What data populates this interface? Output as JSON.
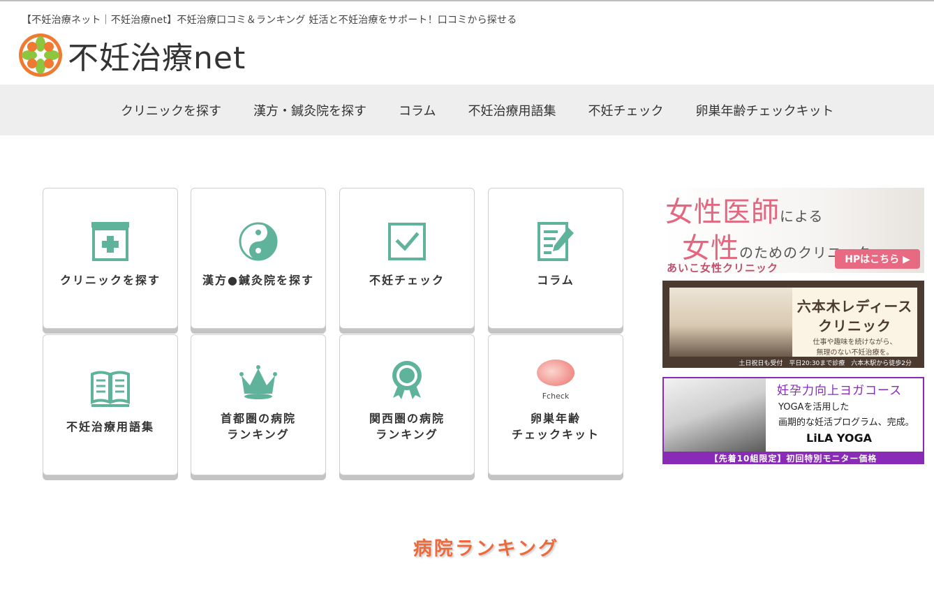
{
  "header": {
    "tagline": "【不妊治療ネット｜不妊治療net】不妊治療口コミ＆ランキング 妊活と不妊治療をサポート！口コミから探せる",
    "logo_text": "不妊治療net"
  },
  "nav": {
    "items": [
      {
        "label": "クリニックを探す"
      },
      {
        "label": "漢方・鍼灸院を探す"
      },
      {
        "label": "コラム"
      },
      {
        "label": "不妊治療用語集"
      },
      {
        "label": "不妊チェック"
      },
      {
        "label": "卵巣年齢チェックキット"
      }
    ]
  },
  "tiles": [
    {
      "icon": "clinic-icon",
      "lines": [
        "クリニックを探す"
      ]
    },
    {
      "icon": "yin-yang-icon",
      "lines": [
        "漢方●鍼灸院を探す"
      ]
    },
    {
      "icon": "checkbox-icon",
      "lines": [
        "不妊チェック"
      ]
    },
    {
      "icon": "note-pencil-icon",
      "lines": [
        "コラム"
      ]
    },
    {
      "icon": "book-icon",
      "lines": [
        "不妊治療用語集"
      ]
    },
    {
      "icon": "crown-icon",
      "lines": [
        "首都圏の病院",
        "ランキング"
      ]
    },
    {
      "icon": "award-badge-icon",
      "lines": [
        "関西圏の病院",
        "ランキング"
      ]
    },
    {
      "icon": "fcheck-logo-icon",
      "lines": [
        "卵巣年齢",
        "チェックキット"
      ],
      "icon_text": "Fcheck"
    }
  ],
  "banners": {
    "aiko": {
      "line1_big": "女性医師",
      "line1_small": "による",
      "line2_big": "女性",
      "line2_small": "のためのクリニック",
      "clinic": "あいこ女性クリニック",
      "button": "HPはこちら ▶"
    },
    "roppongi": {
      "title1": "六本木レディース",
      "title2": "クリニック",
      "sub1": "仕事や趣味を続けながら、",
      "sub2": "無理のない不妊治療を。",
      "footer": "土日祝日も受付　平日20:30まで診療　六本木駅から徒歩2分"
    },
    "yoga": {
      "title": "妊孕力向上ヨガコース",
      "line1": "YOGAを活用した",
      "line2": "画期的な妊活プログラム、完成。",
      "brand": "LiLA YOGA",
      "footer": "【先着10組限定】初回特別モニター価格"
    }
  },
  "section": {
    "title": "病院ランキング"
  },
  "colors": {
    "accent_green": "#5fb39b",
    "section_orange": "#ec6a3c",
    "nav_bg": "#eeeeee"
  }
}
